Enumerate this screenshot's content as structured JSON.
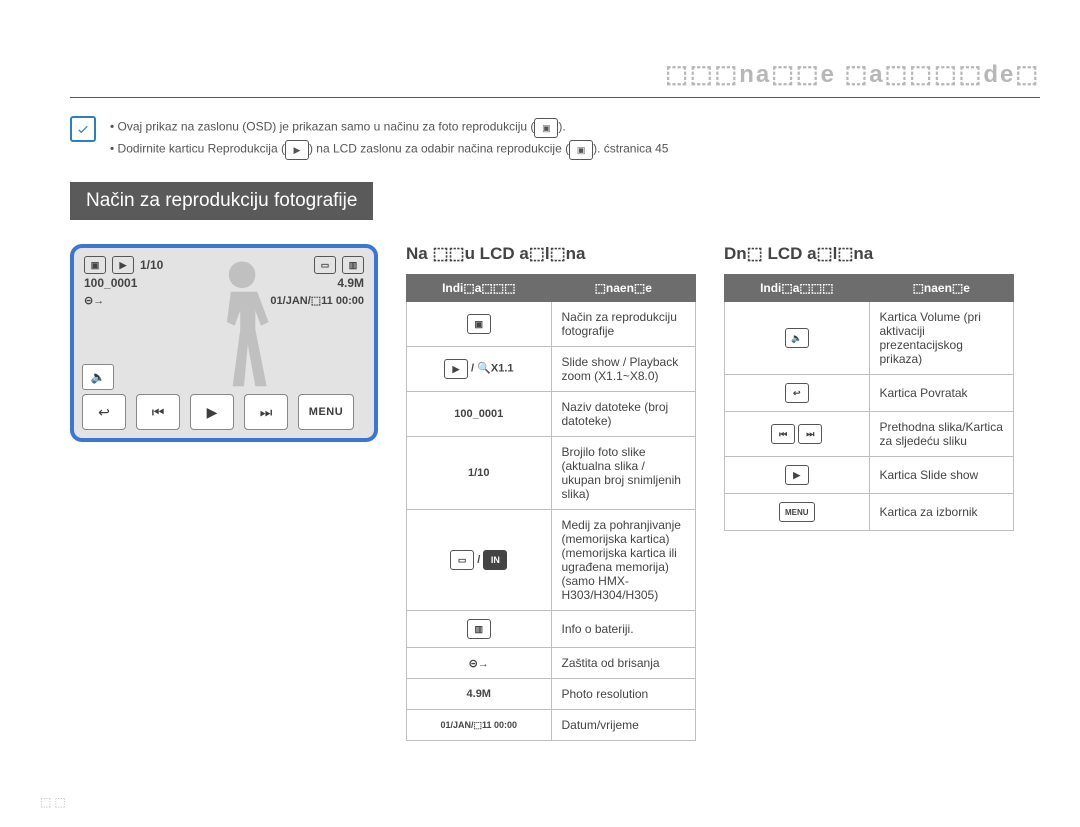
{
  "chapter_title": "⬚⬚⬚na⬚⬚e ⬚a⬚⬚⬚⬚de⬚",
  "notes": {
    "line1": "Ovaj prikaz na zaslonu (OSD) je prikazan samo u načinu za foto reprodukciju (",
    "line1_end": ").",
    "line2_a": "Dodirnite karticu Reprodukcija (",
    "line2_b": ") na LCD zaslonu za odabir načina reprodukcije (",
    "line2_c": "). ",
    "line2_ref": "ćstranica 45"
  },
  "section_title": "Način za reprodukciju fotografije",
  "lcd": {
    "counter": "1/10",
    "folder": "100_0001",
    "res": "4.9M",
    "datetime": "01/JAN/⬚11 00:00",
    "menu": "MENU"
  },
  "left": {
    "heading": "Na ⬚⬚u LCD a⬚l⬚na",
    "th_ind": "Indi⬚a⬚⬚⬚",
    "th_mean": "⬚naen⬚e",
    "rows": [
      {
        "ind": "photo-mode-icon",
        "meaning": "Način za reprodukciju fotografije"
      },
      {
        "ind": "slide-zoom",
        "meaning": "Slide show / Playback zoom (X1.1~X8.0)"
      },
      {
        "ind": "100_0001",
        "meaning": "Naziv datoteke (broj datoteke)"
      },
      {
        "ind": "1/10",
        "meaning": "Brojilo foto slike (aktualna slika / ukupan broj snimljenih slika)"
      },
      {
        "ind": "card-mem",
        "meaning": "Medij za pohranjivanje (memorijska kartica) (memorijska kartica ili ugrađena memorija) (samo HMX-H303/H304/H305)"
      },
      {
        "ind": "battery",
        "meaning": "Info o bateriji."
      },
      {
        "ind": "protect",
        "meaning": "Zaštita od brisanja"
      },
      {
        "ind": "4.9M",
        "meaning": "Photo resolution"
      },
      {
        "ind": "01/JAN/⬚11 00:00",
        "meaning": "Datum/vrijeme"
      }
    ]
  },
  "right": {
    "heading": "Dn⬚ LCD a⬚l⬚na",
    "th_ind": "Indi⬚a⬚⬚⬚",
    "th_mean": "⬚naen⬚e",
    "rows": [
      {
        "ind": "volume-tab",
        "meaning": "Kartica Volume (pri aktivaciji prezentacijskog prikaza)"
      },
      {
        "ind": "return-tab",
        "meaning": "Kartica Povratak"
      },
      {
        "ind": "prev-next",
        "meaning": "Prethodna slika/Kartica za sljedeću sliku"
      },
      {
        "ind": "slideshow-tab",
        "meaning": "Kartica Slide show"
      },
      {
        "ind": "menu-tab",
        "meaning": "Kartica za izbornik"
      }
    ]
  },
  "page_number": "⬚⬚"
}
